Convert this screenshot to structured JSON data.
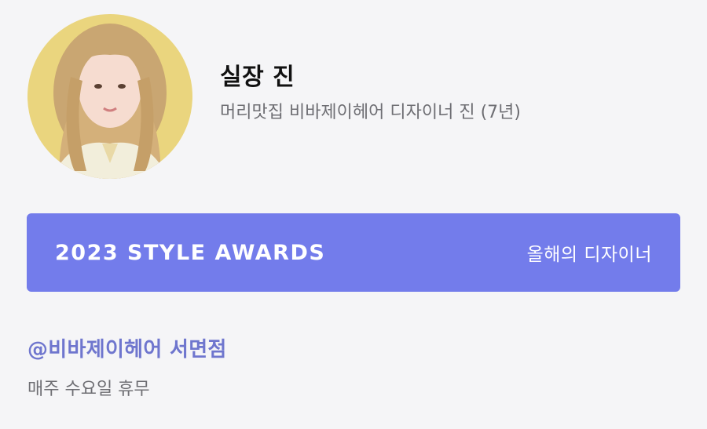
{
  "profile": {
    "name": "실장 진",
    "subtitle": "머리맛집 비바제이헤어 디자이너 진 (7년)"
  },
  "award": {
    "title": "2023 STYLE AWARDS",
    "label": "올해의 디자이너",
    "color": "#737ceb"
  },
  "salon": {
    "name": "@비바제이헤어 서면점",
    "closed_day": "매주 수요일 휴무",
    "accent_color": "#6f76ce"
  }
}
